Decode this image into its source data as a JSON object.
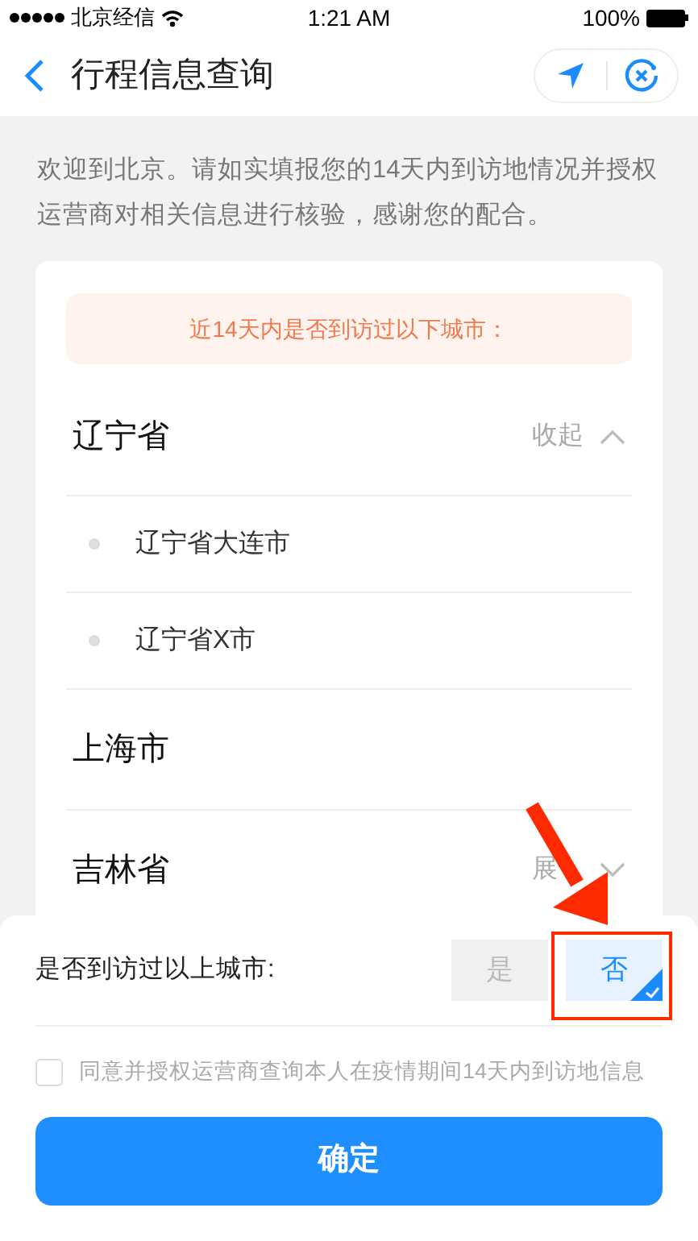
{
  "status_bar": {
    "carrier": "北京经信",
    "time": "1:21 AM",
    "battery": "100%"
  },
  "nav": {
    "title": "行程信息查询"
  },
  "intro": "欢迎到北京。请如实填报您的14天内到访地情况并授权运营商对相关信息进行核验，感谢您的配合。",
  "notice": "近14天内是否到访过以下城市：",
  "provinces": [
    {
      "name": "辽宁省",
      "toggle": "收起",
      "expanded": true,
      "children": [
        {
          "name": "辽宁省大连市"
        },
        {
          "name": "辽宁省X市"
        }
      ]
    },
    {
      "name": "上海市"
    },
    {
      "name": "吉林省",
      "toggle": "展",
      "expanded": false
    }
  ],
  "question": {
    "label": "是否到访过以上城市:",
    "options": [
      {
        "label": "是",
        "selected": false
      },
      {
        "label": "否",
        "selected": true
      }
    ]
  },
  "consent": {
    "label": "同意并授权运营商查询本人在疫情期间14天内到访地信息",
    "checked": false
  },
  "confirm": "确定"
}
